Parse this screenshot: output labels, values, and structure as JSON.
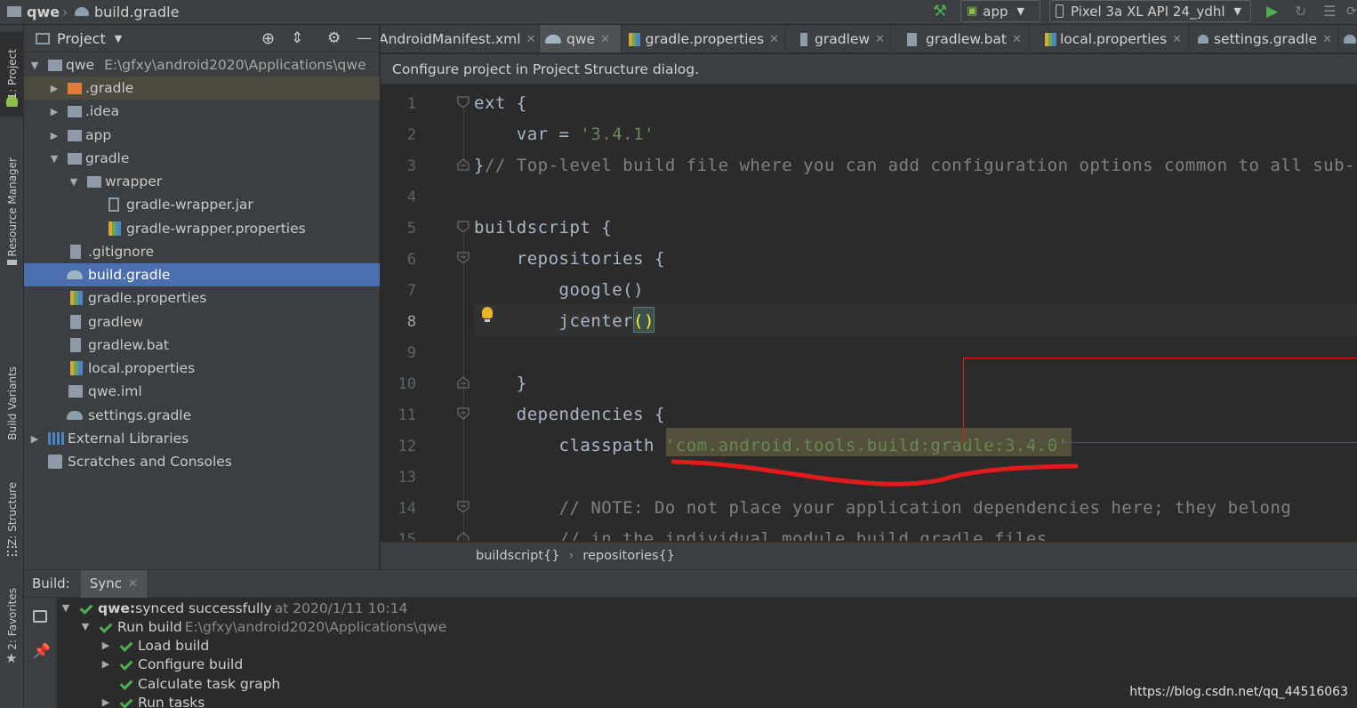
{
  "title_bar": {
    "project": "qwe",
    "file": "build.gradle",
    "run_config": "app",
    "device": "Pixel 3a XL API 24_ydhl"
  },
  "left_strip": {
    "project_tab": "1: Project",
    "resource_tab": "Resource Manager",
    "variants_tab": "Build Variants",
    "structure_tab": "Z: Structure",
    "favorites_tab": "2: Favorites"
  },
  "project_panel": {
    "title": "Project",
    "tree": [
      {
        "label": "qwe",
        "path": "E:\\gfxy\\android2020\\Applications\\qwe"
      },
      {
        "label": ".gradle"
      },
      {
        "label": ".idea"
      },
      {
        "label": "app"
      },
      {
        "label": "gradle"
      },
      {
        "label": "wrapper"
      },
      {
        "label": "gradle-wrapper.jar"
      },
      {
        "label": "gradle-wrapper.properties"
      },
      {
        "label": ".gitignore"
      },
      {
        "label": "build.gradle"
      },
      {
        "label": "gradle.properties"
      },
      {
        "label": "gradlew"
      },
      {
        "label": "gradlew.bat"
      },
      {
        "label": "local.properties"
      },
      {
        "label": "qwe.iml"
      },
      {
        "label": "settings.gradle"
      },
      {
        "label": "External Libraries"
      },
      {
        "label": "Scratches and Consoles"
      }
    ]
  },
  "editor": {
    "tabs": [
      {
        "label": "AndroidManifest.xml"
      },
      {
        "label": "qwe"
      },
      {
        "label": "gradle.properties"
      },
      {
        "label": "gradlew"
      },
      {
        "label": "gradlew.bat"
      },
      {
        "label": "local.properties"
      },
      {
        "label": "settings.gradle"
      }
    ],
    "notice": "Configure project in Project Structure dialog.",
    "lines": {
      "l1": "ext {",
      "l2a": "    var = ",
      "l2b": "'3.4.1'",
      "l3a": "}",
      "l3b": "// Top-level build file where you can add configuration options common to all sub-",
      "l5": "buildscript {",
      "l6": "    repositories {",
      "l7": "        google()",
      "l8a": "        jcenter",
      "l8b": "()",
      "l10": "    }",
      "l11": "    dependencies {",
      "l12a": "        classpath ",
      "l12b": "'com.android.tools.build:gradle:3.4.0'",
      "l14": "        // NOTE: Do not place your application dependencies here; they belong",
      "l15": "        // in the individual module build.gradle files"
    },
    "breadcrumb": {
      "first": "buildscript{}",
      "second": "repositories{}"
    }
  },
  "build_panel": {
    "label": "Build:",
    "tab": "Sync",
    "rows": {
      "r1_bold": "qwe:",
      "r1_text": " synced successfully",
      "r1_time": "at 2020/1/11 10:14",
      "r2_text": "Run build",
      "r2_path": "E:\\gfxy\\android2020\\Applications\\qwe",
      "r3": "Load build",
      "r4": "Configure build",
      "r5": "Calculate task graph",
      "r6": "Run tasks"
    }
  },
  "watermark": "https://blog.csdn.net/qq_44516063",
  "colors": {
    "accent": "#4b6eaf",
    "annotation": "#e11b1b",
    "success": "#4caf50"
  }
}
